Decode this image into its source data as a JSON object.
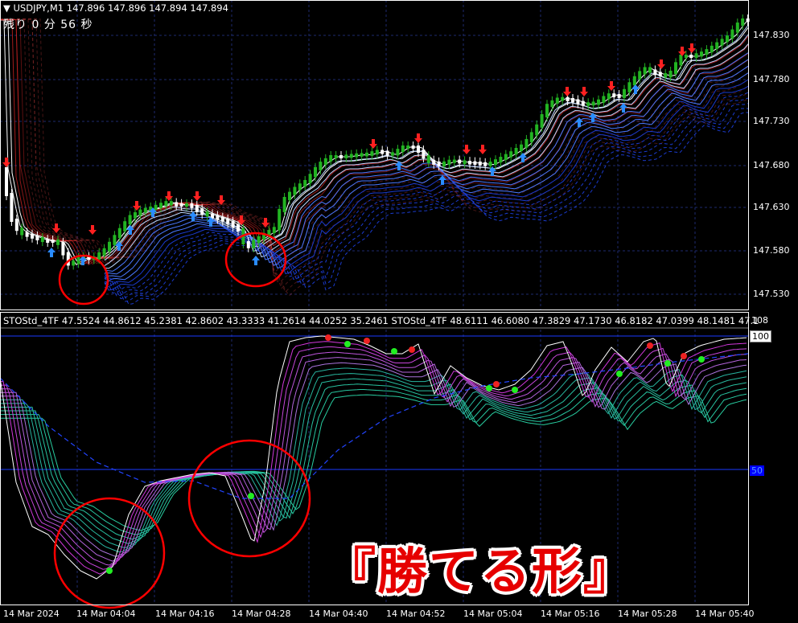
{
  "header": {
    "symbol_tf": "USDJPY,M1",
    "ohlc": "147.896 147.896 147.894 147.894"
  },
  "timer": "残り 0 分 56 秒",
  "stoch_header": "STOStd_4TF 47.5524 44.8612 45.2381 42.8602 43.3333 41.2614 44.0252 35.2461  STOStd_4TF 48.6111 46.6080 47.3829 47.1730 46.8182 47.0399 48.1481 47.1",
  "price_axis": [
    "147.830",
    "147.780",
    "147.730",
    "147.680",
    "147.630",
    "147.580",
    "147.530"
  ],
  "stoch_levels": {
    "top": "108",
    "high": "100",
    "mid": "50"
  },
  "time_axis": [
    "14 Mar 2024",
    "14 Mar 04:04",
    "14 Mar 04:16",
    "14 Mar 04:28",
    "14 Mar 04:40",
    "14 Mar 04:52",
    "14 Mar 05:04",
    "14 Mar 05:16",
    "14 Mar 05:28",
    "14 Mar 05:40"
  ],
  "caption": "『勝てる形』",
  "colors": {
    "bull": "#22b422",
    "bear": "#ffffff",
    "up_arrow": "#2a8cff",
    "down_arrow": "#ff2020",
    "grid": "#1e2a6e",
    "highlight": "#ff0000"
  }
}
